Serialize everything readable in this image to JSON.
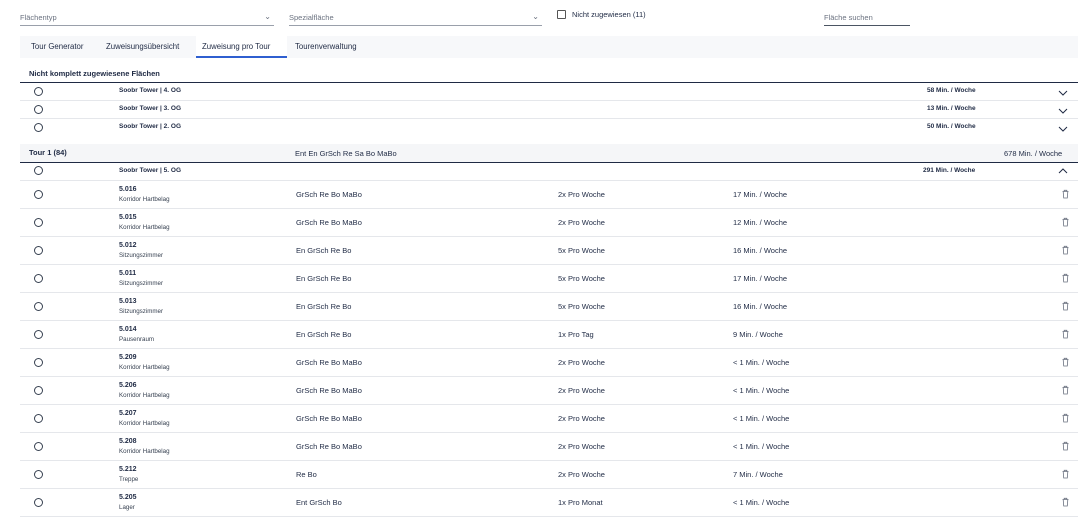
{
  "filters": {
    "flaechentyp": "Flächentyp",
    "spezialflaeche": "Spezialfläche",
    "nicht_zugewiesen": "Nicht zugewiesen (11)",
    "search_placeholder": "Fläche suchen"
  },
  "tabs": [
    {
      "label": "Tour Generator",
      "active": false
    },
    {
      "label": "Zuweisungsübersicht",
      "active": false
    },
    {
      "label": "Zuweisung pro Tour",
      "active": true
    },
    {
      "label": "Tourenverwaltung",
      "active": false
    }
  ],
  "unassigned": {
    "title": "Nicht komplett zugewiesene Flächen",
    "items": [
      {
        "name": "Soobr Tower | 4. OG",
        "time": "58 Min. / Woche"
      },
      {
        "name": "Soobr Tower | 3. OG",
        "time": "13 Min. / Woche"
      },
      {
        "name": "Soobr Tower | 2. OG",
        "time": "50 Min. / Woche"
      }
    ]
  },
  "tour": {
    "title": "Tour 1 (84)",
    "codes": "Ent En GrSch Re Sa Bo MaBo",
    "total": "678 Min. / Woche",
    "floor": {
      "name": "Soobr Tower | 5. OG",
      "time": "291 Min. / Woche"
    },
    "rows": [
      {
        "code": "5.016",
        "type": "Korridor Hartbelag",
        "codes": "GrSch Re Bo MaBo",
        "freq": "2x Pro Woche",
        "time": "17 Min. / Woche"
      },
      {
        "code": "5.015",
        "type": "Korridor Hartbelag",
        "codes": "GrSch Re Bo MaBo",
        "freq": "2x Pro Woche",
        "time": "12 Min. / Woche"
      },
      {
        "code": "5.012",
        "type": "Sitzungszimmer",
        "codes": "En GrSch Re Bo",
        "freq": "5x Pro Woche",
        "time": "16 Min. / Woche"
      },
      {
        "code": "5.011",
        "type": "Sitzungszimmer",
        "codes": "En GrSch Re Bo",
        "freq": "5x Pro Woche",
        "time": "17 Min. / Woche"
      },
      {
        "code": "5.013",
        "type": "Sitzungszimmer",
        "codes": "En GrSch Re Bo",
        "freq": "5x Pro Woche",
        "time": "16 Min. / Woche"
      },
      {
        "code": "5.014",
        "type": "Pausenraum",
        "codes": "En GrSch Re Bo",
        "freq": "1x Pro Tag",
        "time": "9 Min. / Woche"
      },
      {
        "code": "5.209",
        "type": "Korridor Hartbelag",
        "codes": "GrSch Re Bo MaBo",
        "freq": "2x Pro Woche",
        "time": "< 1 Min. / Woche"
      },
      {
        "code": "5.206",
        "type": "Korridor Hartbelag",
        "codes": "GrSch Re Bo MaBo",
        "freq": "2x Pro Woche",
        "time": "< 1 Min. / Woche"
      },
      {
        "code": "5.207",
        "type": "Korridor Hartbelag",
        "codes": "GrSch Re Bo MaBo",
        "freq": "2x Pro Woche",
        "time": "< 1 Min. / Woche"
      },
      {
        "code": "5.208",
        "type": "Korridor Hartbelag",
        "codes": "GrSch Re Bo MaBo",
        "freq": "2x Pro Woche",
        "time": "< 1 Min. / Woche"
      },
      {
        "code": "5.212",
        "type": "Treppe",
        "codes": "Re Bo",
        "freq": "2x Pro Woche",
        "time": "7 Min. / Woche"
      },
      {
        "code": "5.205",
        "type": "Lager",
        "codes": "Ent GrSch Bo",
        "freq": "1x Pro Monat",
        "time": "< 1 Min. / Woche"
      }
    ]
  }
}
